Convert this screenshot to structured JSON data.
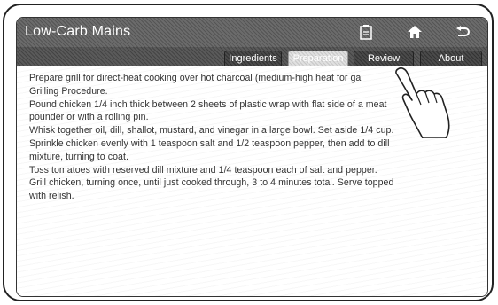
{
  "app": {
    "title": "Low-Carb Mains"
  },
  "controls": {
    "list_icon": "clipboard-icon",
    "home_icon": "home-icon",
    "back_icon": "back-arrow-icon"
  },
  "tabs": [
    {
      "label": "Ingredients",
      "active": false
    },
    {
      "label": "Preparation",
      "active": true
    },
    {
      "label": "Review",
      "active": false
    },
    {
      "label": "About",
      "active": false
    }
  ],
  "content": {
    "paragraphs": [
      "Prepare grill for direct-heat cooking over hot charcoal (medium-high heat for ga",
      "Grilling Procedure.",
      "Pound chicken 1/4 inch thick between 2 sheets of plastic wrap with flat side of a meat",
      "pounder or with a rolling pin.",
      "Whisk together oil, dill, shallot, mustard, and vinegar in a large bowl. Set aside 1/4 cup.",
      "Sprinkle chicken evenly with 1 teaspoon salt and 1/2 teaspoon pepper, then add to dill",
      "mixture, turning to coat.",
      "Toss tomatoes with reserved dill mixture and 1/4 teaspoon each of salt and pepper.",
      "Grill chicken, turning once, until just cooked through, 3 to 4 minutes total. Serve topped",
      "with relish."
    ]
  },
  "colors": {
    "titlebar": "#5e5e5e",
    "tab_active": "#d6d6d6",
    "text": "#333333"
  }
}
